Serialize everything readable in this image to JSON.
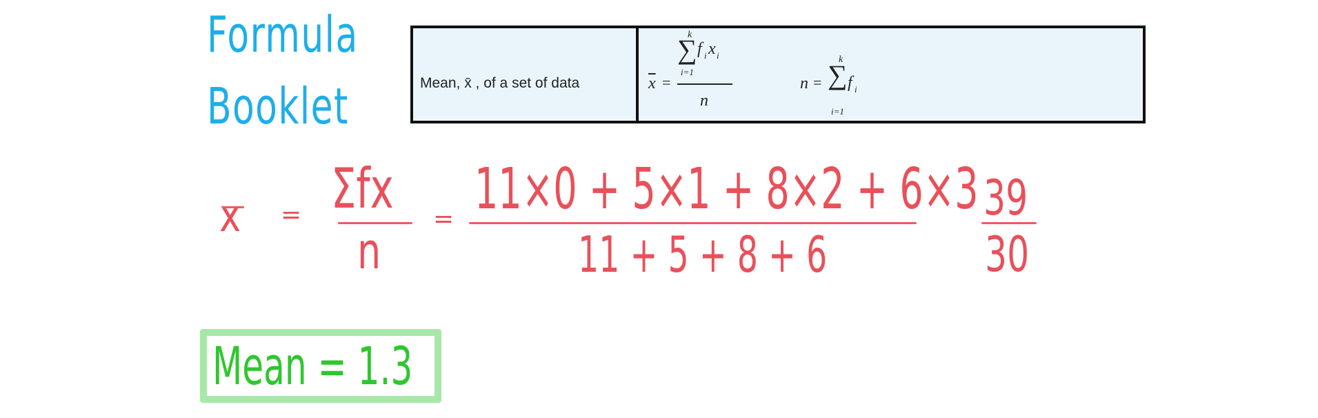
{
  "heading": {
    "line1": "Formula",
    "line2": "Booklet",
    "color": "#1eaeea"
  },
  "formula_booklet": {
    "label": "Mean, x̄ , of a set of data",
    "mean_formula": {
      "lhs": "x",
      "equals": "=",
      "sum_upper": "k",
      "sum_lower": "i=1",
      "sigma": "∑",
      "summand_f": "f",
      "summand_i1": "i",
      "summand_x": "x",
      "summand_i2": "i",
      "denominator": "n"
    },
    "n_formula": {
      "lhs": "n",
      "equals": "=",
      "sigma": "∑",
      "sum_upper": "k",
      "sum_lower": "i=1",
      "summand_f": "f",
      "summand_i": "i"
    },
    "background": "#eaf5fb"
  },
  "working": {
    "color": "#e9505a",
    "lhs": "x",
    "eq1": "=",
    "general_numerator": "Σfx",
    "general_denominator": "n",
    "eq2": "=",
    "numerator": "11×0 + 5×1 + 8×2 + 6×3",
    "denominator": "11 + 5 + 8 + 6",
    "result_numerator": "39",
    "result_denominator": "30"
  },
  "answer": {
    "text": "Mean = 1.3",
    "color": "#2ec72e",
    "border_color": "#a7e8a9"
  }
}
